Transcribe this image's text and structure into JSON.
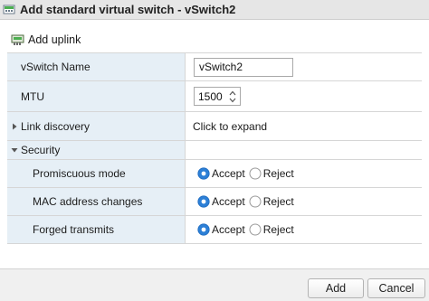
{
  "dialog": {
    "title": "Add standard virtual switch - vSwitch2",
    "add_uplink_label": "Add uplink"
  },
  "form": {
    "vswitch_name": {
      "label": "vSwitch Name",
      "value": "vSwitch2"
    },
    "mtu": {
      "label": "MTU",
      "value": "1500"
    },
    "link_discovery": {
      "label": "Link discovery",
      "value": "Click to expand",
      "expanded": false
    },
    "security": {
      "label": "Security",
      "expanded": true,
      "options": [
        {
          "label": "Promiscuous mode",
          "accept_label": "Accept",
          "reject_label": "Reject",
          "selected": "Accept"
        },
        {
          "label": "MAC address changes",
          "accept_label": "Accept",
          "reject_label": "Reject",
          "selected": "Accept"
        },
        {
          "label": "Forged transmits",
          "accept_label": "Accept",
          "reject_label": "Reject",
          "selected": "Accept"
        }
      ]
    }
  },
  "footer": {
    "add_label": "Add",
    "cancel_label": "Cancel"
  },
  "colors": {
    "label_bg": "#e6eff6",
    "radio_selected": "#2c7fd6",
    "icon_green": "#4caf50"
  },
  "icons": {
    "title_icon": "vswitch-icon",
    "uplink_icon": "network-adapter-icon"
  }
}
